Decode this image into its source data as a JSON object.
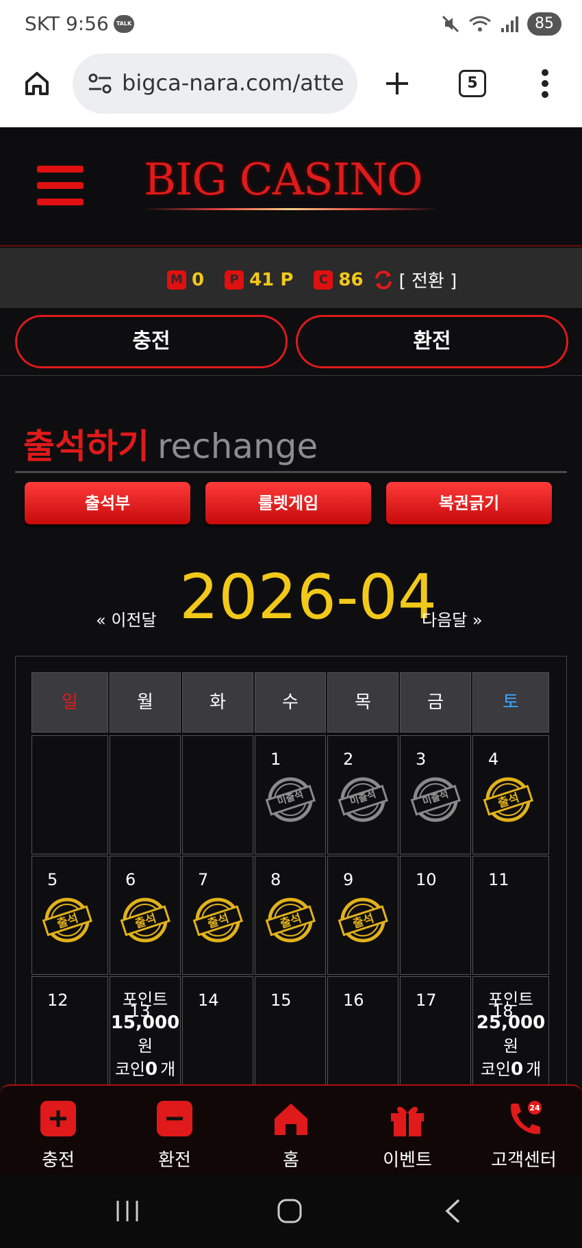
{
  "status_bar": {
    "carrier_time": "SKT 9:56",
    "talk_badge": "TALK",
    "battery": "85"
  },
  "browser": {
    "url": "bigca-nara.com/atte",
    "tab_count": "5"
  },
  "header": {
    "logo": "BIG CASINO"
  },
  "points": {
    "m_label": "M",
    "m_value": "0",
    "p_label": "P",
    "p_value": "41 P",
    "c_label": "C",
    "c_value": "86",
    "switch_label": "[ 전환 ]"
  },
  "actions": {
    "charge": "충전",
    "exchange": "환전"
  },
  "section": {
    "title": "출석하기",
    "subtitle": "rechange"
  },
  "tabs": {
    "attendance": "출석부",
    "roulette": "룰렛게임",
    "lottery": "복권긁기"
  },
  "month_nav": {
    "prev": "« 이전달",
    "month": "2026-04",
    "next": "다음달 »"
  },
  "calendar": {
    "weekdays": [
      "일",
      "월",
      "화",
      "수",
      "목",
      "금",
      "토"
    ],
    "weekday_colors": {
      "sunday": "#e01a1a",
      "saturday": "#3aa7ff",
      "default": "#ffffff"
    },
    "rows": [
      [
        {
          "day": ""
        },
        {
          "day": ""
        },
        {
          "day": ""
        },
        {
          "day": "1",
          "stamp": "미출석"
        },
        {
          "day": "2",
          "stamp": "미출석"
        },
        {
          "day": "3",
          "stamp": "미출석"
        },
        {
          "day": "4",
          "stamp": "출석"
        }
      ],
      [
        {
          "day": "5",
          "stamp": "출석"
        },
        {
          "day": "6",
          "stamp": "출석"
        },
        {
          "day": "7",
          "stamp": "출석"
        },
        {
          "day": "8",
          "stamp": "출석"
        },
        {
          "day": "9",
          "stamp": "출석"
        },
        {
          "day": "10"
        },
        {
          "day": "11"
        }
      ],
      [
        {
          "day": "12"
        },
        {
          "day": "13",
          "reward": {
            "label": "포인트",
            "amount": "15,000",
            "unit": "원",
            "coin_prefix": "코인",
            "coin_value": "0",
            "coin_unit": "개"
          }
        },
        {
          "day": "14"
        },
        {
          "day": "15"
        },
        {
          "day": "16"
        },
        {
          "day": "17"
        },
        {
          "day": "18",
          "reward": {
            "label": "포인트",
            "amount": "25,000",
            "unit": "원",
            "coin_prefix": "코인",
            "coin_value": "0",
            "coin_unit": "개"
          }
        }
      ]
    ]
  },
  "bottom_nav": [
    {
      "label": "충전",
      "icon": "plus-icon"
    },
    {
      "label": "환전",
      "icon": "minus-icon"
    },
    {
      "label": "홈",
      "icon": "home-icon"
    },
    {
      "label": "이벤트",
      "icon": "gift-icon"
    },
    {
      "label": "고객센터",
      "icon": "phone-24-icon",
      "badge": "24"
    }
  ],
  "colors": {
    "accent_red": "#e01a1a",
    "gold": "#f2c919",
    "background": "#0e0e10"
  }
}
